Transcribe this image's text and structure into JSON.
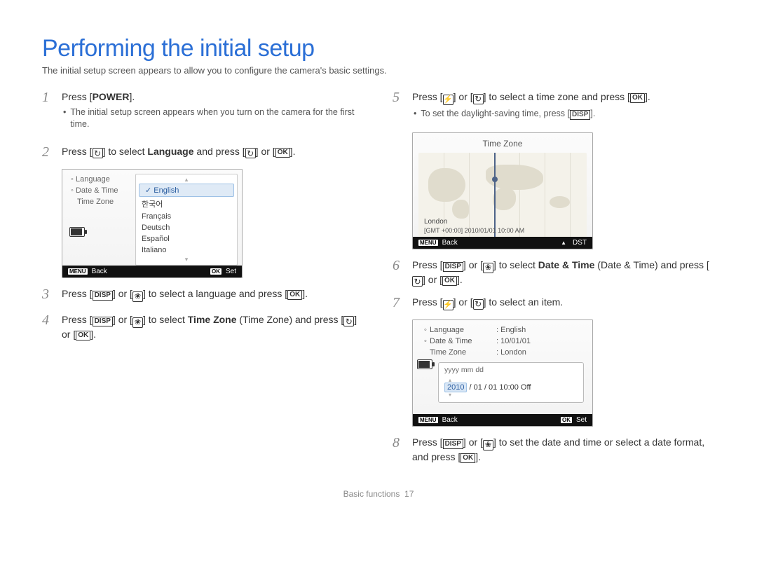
{
  "page": {
    "title": "Performing the initial setup",
    "subtitle": "The initial setup screen appears to allow you to configure the camera's basic settings.",
    "footer_section": "Basic functions",
    "footer_page": "17"
  },
  "buttons": {
    "power": "POWER",
    "ok": "OK",
    "disp": "DISP",
    "menu": "MENU",
    "back": "Back",
    "set": "Set",
    "dst": "DST"
  },
  "steps": {
    "s1": {
      "num": "1",
      "pre": "Press [",
      "post": "]."
    },
    "s1b": "The initial setup screen appears when you turn on the camera for the first time.",
    "s2": {
      "num": "2",
      "p1": "Press [",
      "p2": "] to select ",
      "bold": "Language",
      "p3": " and press [",
      "p4": "] or [",
      "p5": "]."
    },
    "s3": {
      "num": "3",
      "p1": "Press [",
      "p2": "] or [",
      "p3": "] to select a language and press [",
      "p4": "]."
    },
    "s4": {
      "num": "4",
      "p1": "Press [",
      "p2": "] or [",
      "p3": "] to select ",
      "bold": "Time Zone",
      "paren": " (Time Zone) and press [",
      "p4": "] or [",
      "p5": "]."
    },
    "s5": {
      "num": "5",
      "p1": "Press [",
      "p2": "] or [",
      "p3": "] to select a time zone and press [",
      "p4": "]."
    },
    "s5b": {
      "p1": "To set the daylight-saving time, press [",
      "p2": "]."
    },
    "s6": {
      "num": "6",
      "p1": "Press [",
      "p2": "] or [",
      "p3": "] to select ",
      "bold": "Date & Time",
      "paren": " (Date & Time) and press [",
      "p4": "] or [",
      "p5": "]."
    },
    "s7": {
      "num": "7",
      "p1": "Press [",
      "p2": "] or [",
      "p3": "] to select an item."
    },
    "s8": {
      "num": "8",
      "p1": "Press [",
      "p2": "] or [",
      "p3": "] to set the date and time or select a date format, and press [",
      "p4": "]."
    }
  },
  "lcd_lang": {
    "menu": {
      "language": "Language",
      "datetime": "Date & Time",
      "timezone": "Time Zone"
    },
    "options": [
      "English",
      "한국어",
      "Français",
      "Deutsch",
      "Español",
      "Italiano"
    ],
    "selected": "English"
  },
  "lcd_tz": {
    "title": "Time Zone",
    "city": "London",
    "detail": "[GMT +00:00] 2010/01/01 10:00 AM"
  },
  "lcd_dt": {
    "rows": {
      "language": {
        "label": "Language",
        "value": ": English"
      },
      "datetime": {
        "label": "Date & Time",
        "value": ": 10/01/01"
      },
      "timezone": {
        "label": "Time Zone",
        "value": ": London"
      }
    },
    "fmt_header": "yyyy  mm  dd",
    "val_year": "2010",
    "val_rest": " / 01 / 01  10:00   Off"
  }
}
